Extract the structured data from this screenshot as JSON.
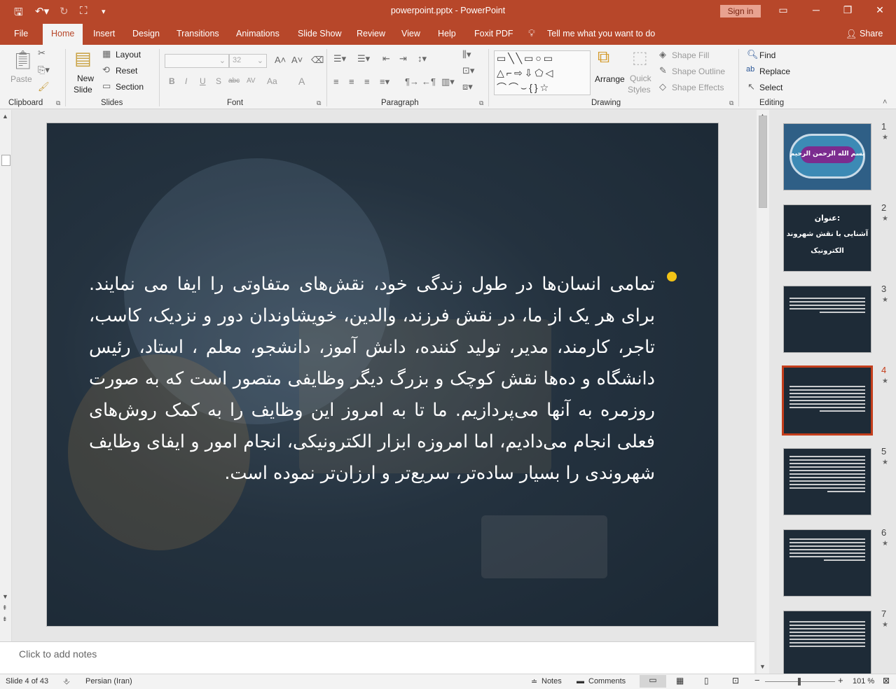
{
  "window": {
    "title": "powerpoint.pptx - PowerPoint",
    "sign_in": "Sign in"
  },
  "tabs": [
    "File",
    "Home",
    "Insert",
    "Design",
    "Transitions",
    "Animations",
    "Slide Show",
    "Review",
    "View",
    "Help",
    "Foxit PDF"
  ],
  "active_tab": "Home",
  "tell_me": "Tell me what you want to do",
  "share": "Share",
  "ribbon": {
    "clipboard": {
      "label": "Clipboard",
      "paste": "Paste"
    },
    "slides": {
      "label": "Slides",
      "new_slide_1": "New",
      "new_slide_2": "Slide",
      "layout": "Layout",
      "reset": "Reset",
      "section": "Section"
    },
    "font": {
      "label": "Font",
      "font_size": "32",
      "bold": "B",
      "italic": "I",
      "underline": "U",
      "shadow": "S",
      "strike": "abc",
      "spacing": "AV",
      "case": "Aa",
      "color": "A"
    },
    "paragraph": {
      "label": "Paragraph"
    },
    "drawing": {
      "label": "Drawing",
      "arrange": "Arrange",
      "quick_styles_1": "Quick",
      "quick_styles_2": "Styles",
      "shape_fill": "Shape Fill",
      "shape_outline": "Shape Outline",
      "shape_effects": "Shape Effects"
    },
    "editing": {
      "label": "Editing",
      "find": "Find",
      "replace": "Replace",
      "select": "Select"
    }
  },
  "slide": {
    "body_text": "تمامی انسان‌ها در طول زندگی خود، نقش‌های متفاوتی را ایفا می نمایند. برای هر یک از ما، در نقش فرزند، والدین، خویشاوندان دور و نزدیک، کاسب، تاجر، کارمند، مدیر، تولید کننده، دانش آموز، دانشجو، معلم ، استاد، رئیس دانشگاه و ده‌ها نقش کوچک و بزرگ دیگر وظایفی متصور است که به صورت روزمره به آنها می‌پردازیم. ما تا به امروز این وظایف را به کمک روش‌های فعلی انجام می‌دادیم، اما امروزه ابزار الکترونیکی، انجام امور و ایفای وظایف شهروندی را بسیار ساده‌تر، سریع‌تر و ارزان‌تر نموده است.",
    "bullet_color": "#f2c316"
  },
  "notes_placeholder": "Click to add notes",
  "thumbnails": [
    {
      "num": "1",
      "star": "★",
      "title": "بسم الله الرحمن الرحیم"
    },
    {
      "num": "2",
      "star": "★",
      "line1": "عنوان:",
      "line2": "آشنایی با نقش شهروند",
      "line3": "الکترونیک"
    },
    {
      "num": "3",
      "star": "★"
    },
    {
      "num": "4",
      "star": "★"
    },
    {
      "num": "5",
      "star": "★"
    },
    {
      "num": "6",
      "star": "★"
    },
    {
      "num": "7",
      "star": "★"
    }
  ],
  "active_slide": "4",
  "status": {
    "slide_info": "Slide 4 of 43",
    "language": "Persian (Iran)",
    "notes": "Notes",
    "comments": "Comments",
    "zoom": "101 %"
  },
  "colors": {
    "accent": "#b7472a",
    "ribbon_bg": "#f3f3f3",
    "active_thumb_border": "#c43e1c"
  }
}
